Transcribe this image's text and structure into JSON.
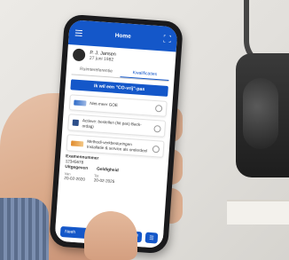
{
  "app": {
    "title": "Home",
    "menu_icon": "menu-icon",
    "scan_icon": "qr-scan-icon"
  },
  "profile": {
    "name": "P. J. Jansen",
    "date": "27 juni 1982"
  },
  "tabs": [
    {
      "label": "Ruimtereferentie",
      "active": false
    },
    {
      "label": "Kwalificaties",
      "active": true
    }
  ],
  "cta_label": "Ik wil een \"CO-vrij\"-pas",
  "cards": [
    {
      "text": "Niet-meer GOE",
      "logo": "blue"
    },
    {
      "text": "Actieve: bestellen (hit pas) Back-ordag)",
      "logo": "square"
    },
    {
      "text": "Methodi-verkbesturingen Installatie & service als onderdeel",
      "logo": "orange"
    }
  ],
  "details": {
    "label": "Examennummer",
    "number": "12345678",
    "uitgegeven_label": "Uitgegeven",
    "geldigheid_label": "Geldigheid",
    "van_label": "Van",
    "tot_label": "Tot",
    "van": "20-02-2020",
    "tot": "20-02-2025"
  },
  "bottom": {
    "left_label": "Neeh",
    "mid_icon": "trash-icon",
    "right_icon": "list-icon"
  },
  "colors": {
    "primary": "#1457c9"
  }
}
